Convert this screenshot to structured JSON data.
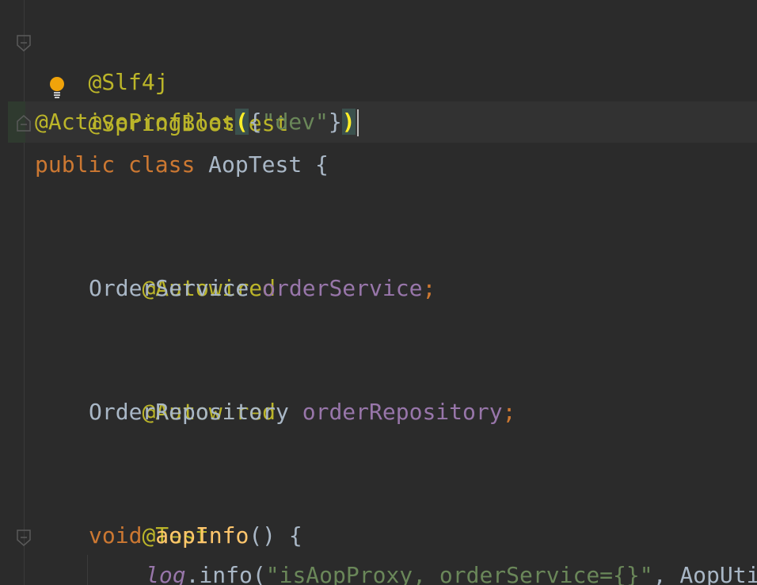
{
  "editor": {
    "lines": [
      {
        "id": "l1",
        "tokens": [
          "@Slf4j"
        ]
      },
      {
        "id": "l2",
        "tokens": [
          "@SpringBootTest"
        ]
      },
      {
        "id": "l3",
        "tokens": [
          "@ActiveProfiles",
          "(",
          "{",
          "\"dev\"",
          "}",
          ")"
        ]
      },
      {
        "id": "l4",
        "tokens": [
          "public",
          "class",
          "AopTest",
          "{"
        ]
      },
      {
        "id": "l6",
        "tokens": [
          "@Autowired"
        ]
      },
      {
        "id": "l7",
        "tokens": [
          "OrderService",
          "orderService",
          ";"
        ]
      },
      {
        "id": "l9",
        "tokens": [
          "@Autowired"
        ]
      },
      {
        "id": "l10",
        "tokens": [
          "OrderRepository",
          "orderRepository",
          ";"
        ]
      },
      {
        "id": "l12",
        "tokens": [
          "@Test"
        ]
      },
      {
        "id": "l13",
        "tokens": [
          "void",
          "aopInfo",
          "()",
          "{"
        ]
      },
      {
        "id": "l14",
        "tokens": [
          "log",
          ".info(",
          "\"isAopProxy, orderService={}\"",
          ", AopUti"
        ]
      }
    ]
  },
  "colors": {
    "background": "#2b2b2b",
    "annotation": "#bbb529",
    "keyword": "#cc7832",
    "identifier": "#a9b7c6",
    "field": "#9876aa",
    "string": "#6a8759",
    "method": "#ffc66d",
    "brace_match_bg": "#3b514d",
    "brace_match_fg": "#ffef28"
  },
  "icons": {
    "fold_marker": "fold-marker-icon",
    "intention_bulb": "lightbulb-icon"
  }
}
